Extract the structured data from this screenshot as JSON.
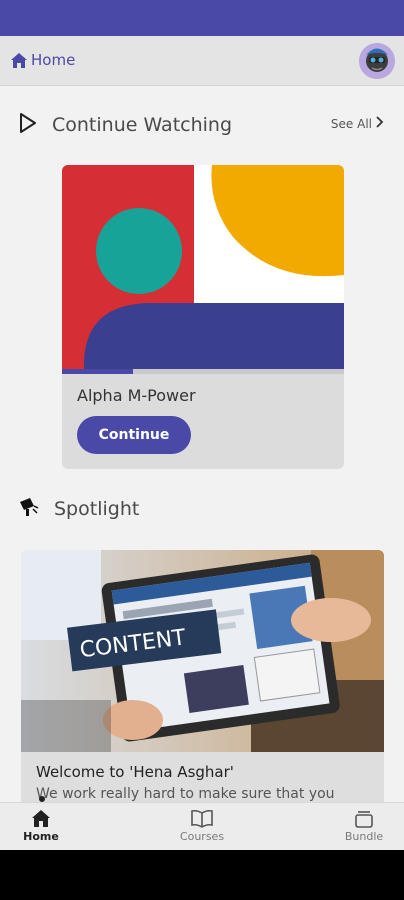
{
  "colors": {
    "brand": "#4b49a8",
    "background": "#f2f2f2",
    "card": "#dcdcdc"
  },
  "app_bar": {
    "home_label": "Home",
    "home_icon": "home-icon",
    "avatar": "user-avatar"
  },
  "continue_watching": {
    "title": "Continue Watching",
    "see_all": "See All",
    "card": {
      "title": "Alpha M-Power",
      "button": "Continue",
      "progress": 0.25
    }
  },
  "spotlight": {
    "title": "Spotlight",
    "card": {
      "image_text": "CONTENT",
      "title": "Welcome to 'Hena Asghar'",
      "description": "We work really hard to make sure that you"
    }
  },
  "bottom_nav": [
    {
      "label": "Home",
      "icon": "home-icon",
      "active": true
    },
    {
      "label": "Courses",
      "icon": "book-icon",
      "active": false
    },
    {
      "label": "Bundle",
      "icon": "bundle-icon",
      "active": false
    }
  ]
}
